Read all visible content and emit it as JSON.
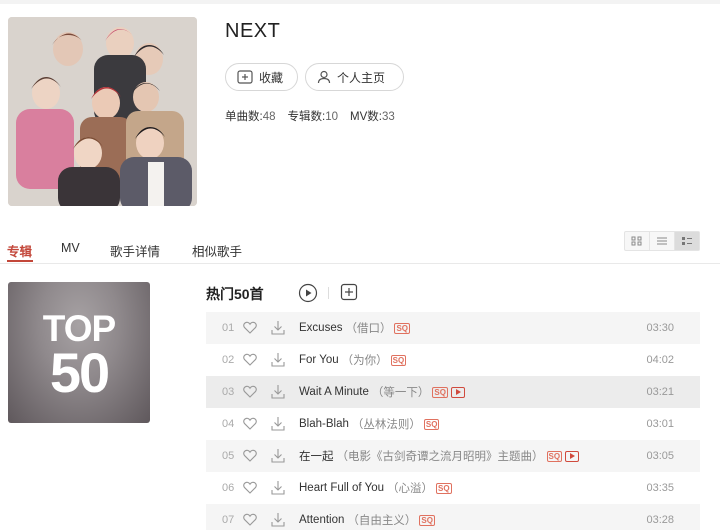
{
  "artist": {
    "name": "NEXT",
    "collect_label": "收藏",
    "homepage_label": "个人主页",
    "stats": [
      {
        "label": "单曲数:",
        "value": "48"
      },
      {
        "label": "专辑数:",
        "value": "10"
      },
      {
        "label": "MV数:",
        "value": "33"
      }
    ]
  },
  "tabs": [
    "专辑",
    "MV",
    "歌手详情",
    "相似歌手"
  ],
  "album": {
    "cover_line1": "TOP",
    "cover_line2": "50",
    "title": "热门50首"
  },
  "songs": [
    {
      "num": "01",
      "title": "Excuses",
      "sub": "（借口）",
      "sq": "SQ",
      "mv": false,
      "duration": "03:30"
    },
    {
      "num": "02",
      "title": "For You",
      "sub": "（为你）",
      "sq": "SQ",
      "mv": false,
      "duration": "04:02"
    },
    {
      "num": "03",
      "title": "Wait A Minute",
      "sub": "（等一下）",
      "sq": "SQ",
      "mv": true,
      "duration": "03:21"
    },
    {
      "num": "04",
      "title": "Blah-Blah",
      "sub": "（丛林法则）",
      "sq": "SQ",
      "mv": false,
      "duration": "03:01"
    },
    {
      "num": "05",
      "title": "在一起",
      "sub": "（电影《古剑奇谭之流月昭明》主题曲）",
      "sq": "SQ",
      "mv": true,
      "duration": "03:05"
    },
    {
      "num": "06",
      "title": "Heart Full of You",
      "sub": "（心溢）",
      "sq": "SQ",
      "mv": false,
      "duration": "03:35"
    },
    {
      "num": "07",
      "title": "Attention",
      "sub": "（自由主义）",
      "sq": "SQ",
      "mv": false,
      "duration": "03:28"
    }
  ],
  "colors": {
    "accent": "#c3473a",
    "sq_badge": "#e0715f"
  }
}
